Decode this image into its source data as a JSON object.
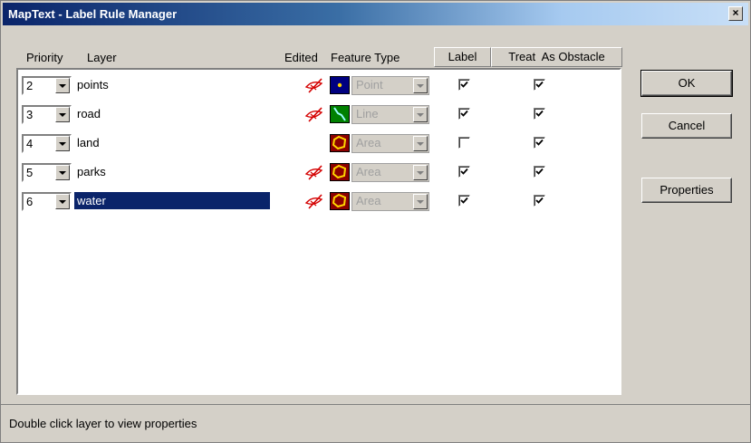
{
  "window": {
    "title": "MapText - Label Rule Manager",
    "close_glyph": "×"
  },
  "headers": {
    "priority": "Priority",
    "layer": "Layer",
    "edited": "Edited",
    "feature_type": "Feature Type",
    "label": "Label",
    "treat_as_obstacle": "Treat  As Obstacle"
  },
  "rows": [
    {
      "priority": "2",
      "layer": "points",
      "edited": true,
      "feature_icon": "point-feature-icon",
      "feature_type": "Point",
      "label": true,
      "obstacle": true,
      "selected": false
    },
    {
      "priority": "3",
      "layer": "road",
      "edited": true,
      "feature_icon": "line-feature-icon",
      "feature_type": "Line",
      "label": true,
      "obstacle": true,
      "selected": false
    },
    {
      "priority": "4",
      "layer": "land",
      "edited": false,
      "feature_icon": "area-feature-icon",
      "feature_type": "Area",
      "label": false,
      "obstacle": true,
      "selected": false
    },
    {
      "priority": "5",
      "layer": "parks",
      "edited": true,
      "feature_icon": "area-feature-icon",
      "feature_type": "Area",
      "label": true,
      "obstacle": true,
      "selected": false
    },
    {
      "priority": "6",
      "layer": "water",
      "edited": true,
      "feature_icon": "area-feature-icon",
      "feature_type": "Area",
      "label": true,
      "obstacle": true,
      "selected": true
    }
  ],
  "buttons": {
    "ok": "OK",
    "cancel": "Cancel",
    "properties": "Properties"
  },
  "status": "Double click layer to view properties",
  "colors": {
    "title_bar": "#0a246a",
    "selection": "#0a246a",
    "edited_mark": "#d40000",
    "area_icon_bg": "#8b0000",
    "area_icon_fill": "#ffd700",
    "line_icon_bg": "#008000",
    "point_icon_bg": "#000080"
  }
}
